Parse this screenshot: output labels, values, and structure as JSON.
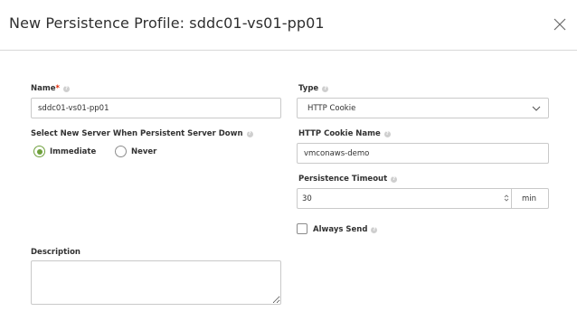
{
  "dialog": {
    "title": "New Persistence Profile: sddc01-vs01-pp01"
  },
  "form": {
    "name": {
      "label": "Name",
      "required_mark": "*",
      "value": "sddc01-vs01-pp01"
    },
    "select_new_server": {
      "label": "Select New Server When Persistent Server Down",
      "options": [
        "Immediate",
        "Never"
      ],
      "selected": "Immediate"
    },
    "type": {
      "label": "Type",
      "value": "HTTP Cookie"
    },
    "cookie_name": {
      "label": "HTTP Cookie Name",
      "value": "vmconaws-demo"
    },
    "persistence_timeout": {
      "label": "Persistence Timeout",
      "value": "30",
      "unit": "min"
    },
    "always_send": {
      "label": "Always Send",
      "checked": false
    },
    "description": {
      "label": "Description",
      "value": ""
    }
  },
  "icons": {
    "close": "close-icon",
    "info": "info-icon",
    "dropdown": "chevron-down-icon",
    "stepper": "stepper-icon"
  },
  "colors": {
    "required": "#e12400",
    "radio_selected": "#6ea03c",
    "border": "#c9c9c9"
  }
}
